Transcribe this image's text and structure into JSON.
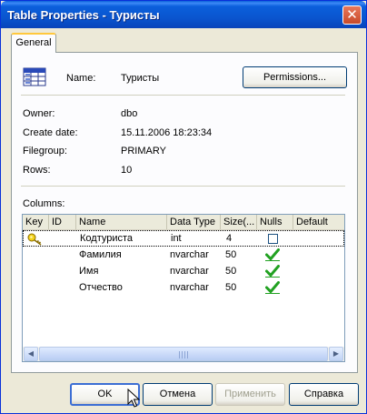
{
  "window": {
    "title": "Table Properties - Туристы",
    "close_glyph": "✕"
  },
  "tabs": [
    {
      "label": "General",
      "active": true
    }
  ],
  "header": {
    "name_label": "Name:",
    "name_value": "Туристы",
    "permissions_label": "Permissions...",
    "icon": "table-icon"
  },
  "properties": [
    {
      "label": "Owner:",
      "value": "dbo"
    },
    {
      "label": "Create date:",
      "value": "15.11.2006 18:23:34"
    },
    {
      "label": "Filegroup:",
      "value": "PRIMARY"
    },
    {
      "label": "Rows:",
      "value": "10"
    }
  ],
  "columns_section": {
    "label": "Columns:",
    "headers": [
      "Key",
      "ID",
      "Name",
      "Data Type",
      "Size(...",
      "Nulls",
      "Default"
    ],
    "rows": [
      {
        "key": true,
        "id": "",
        "name": "Кодтуриста",
        "data_type": "int",
        "size": "4",
        "nulls": false,
        "default": "",
        "selected": true
      },
      {
        "key": false,
        "id": "",
        "name": "Фамилия",
        "data_type": "nvarchar",
        "size": "50",
        "nulls": true,
        "default": "",
        "selected": false
      },
      {
        "key": false,
        "id": "",
        "name": "Имя",
        "data_type": "nvarchar",
        "size": "50",
        "nulls": true,
        "default": "",
        "selected": false
      },
      {
        "key": false,
        "id": "",
        "name": "Отчество",
        "data_type": "nvarchar",
        "size": "50",
        "nulls": true,
        "default": "",
        "selected": false
      }
    ],
    "scroll_left_glyph": "◀",
    "scroll_right_glyph": "▶"
  },
  "buttons": {
    "ok": "OK",
    "cancel": "Отмена",
    "apply": "Применить",
    "help": "Справка"
  },
  "colors": {
    "titlebar": "#0a56d0",
    "dialog_bg": "#ece9d8",
    "check_green": "#21a121",
    "tab_accent": "#ffc83c"
  }
}
